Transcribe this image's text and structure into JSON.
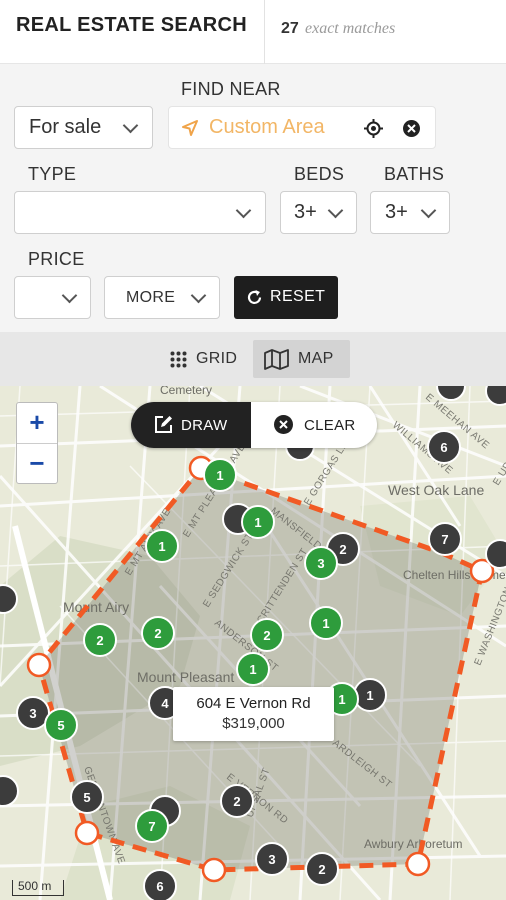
{
  "header": {
    "title": "REAL ESTATE SEARCH",
    "count": "27",
    "matches_text": "exact matches"
  },
  "filters": {
    "listing_type": {
      "value": "For sale"
    },
    "find_near": {
      "label": "FIND NEAR",
      "placeholder": "Custom Area"
    },
    "type": {
      "label": "TYPE",
      "value": ""
    },
    "beds": {
      "label": "BEDS",
      "value": "3+"
    },
    "baths": {
      "label": "BATHS",
      "value": "3+"
    },
    "price": {
      "label": "PRICE",
      "value": ""
    },
    "more_label": "MORE",
    "reset_label": "RESET"
  },
  "view_toggle": {
    "grid_label": "GRID",
    "map_label": "MAP",
    "active": "MAP"
  },
  "map": {
    "zoom_in": "+",
    "zoom_out": "−",
    "draw_label": "DRAW",
    "clear_label": "CLEAR",
    "popup": {
      "address": "604 E Vernon Rd",
      "price": "$319,000"
    },
    "scale_label": "500 m",
    "place_labels": [
      "West Oak Lane",
      "Chelten Hills Cemetery",
      "Mount Airy",
      "Mount Pleasant",
      "Awbury Arboretum",
      "Cemetery"
    ],
    "street_labels": [
      "E MT PLEASANT AVE",
      "E SEDGWICK ST",
      "CRITTENDEN ST",
      "E GORGAS LN",
      "WILLIAMS AVE",
      "E UPSAL ST",
      "UPSAL ST",
      "ARDLEIGH ST",
      "E VERNON RD",
      "GERMANTOWN AVE",
      "MANSFIELD AVE",
      "E WASHINGTON LN",
      "ANDERSON ST",
      "E MT AIRY AVE",
      "E MEEHAN AVE"
    ],
    "clusters_inside": [
      "1",
      "1",
      "1",
      "3",
      "2",
      "2",
      "1",
      "2",
      "1",
      "1",
      "5",
      "7",
      "1"
    ],
    "clusters_outside": [
      "6",
      "7",
      "2",
      "3",
      "4",
      "5",
      "2",
      "2",
      "3",
      "1",
      "6"
    ],
    "colors": {
      "inside_marker": "#2e9c3c",
      "outside_marker": "#3c3c3c",
      "polygon_line": "#f15a24",
      "map_bg": "#e9ead9"
    }
  }
}
